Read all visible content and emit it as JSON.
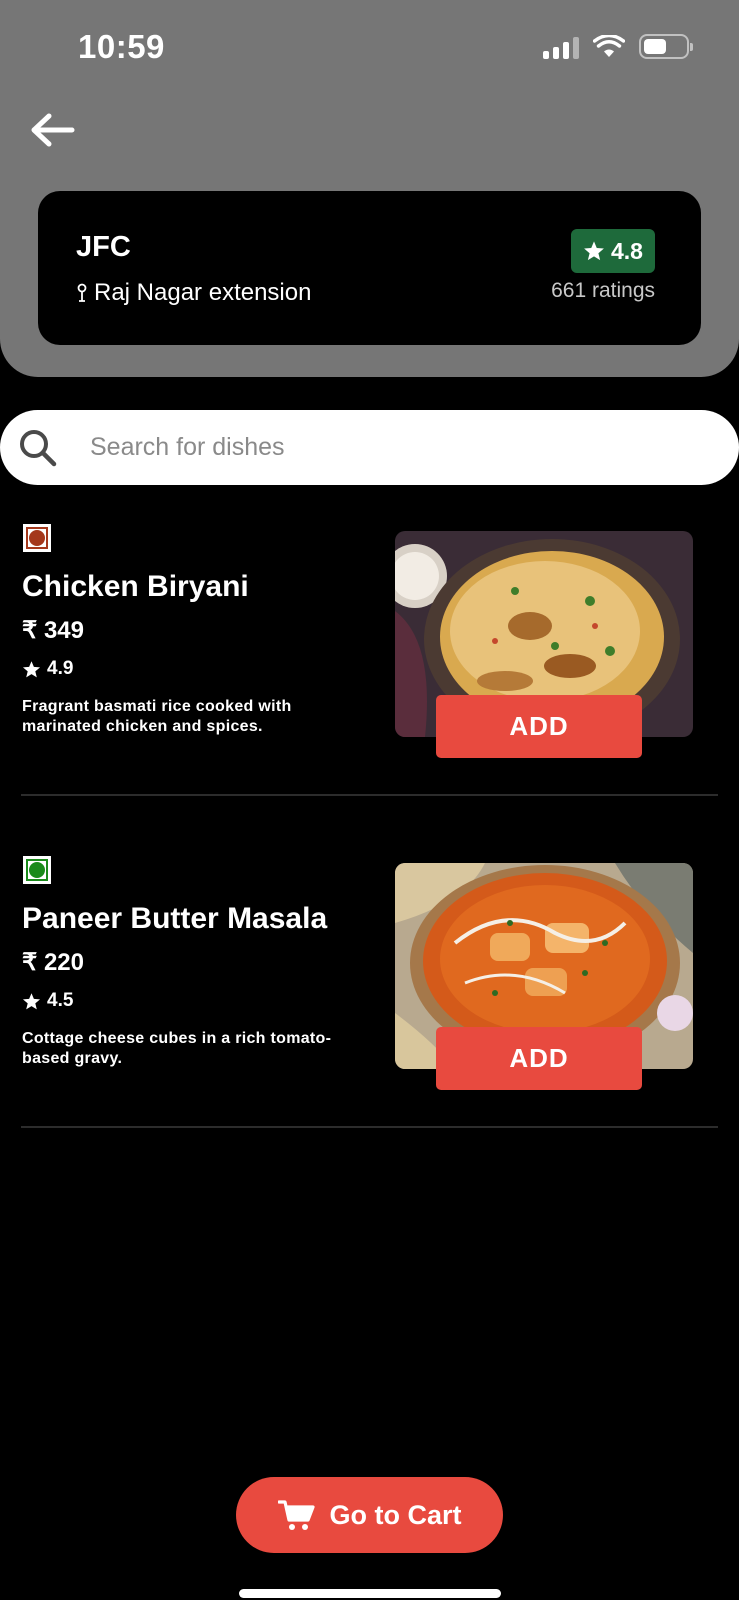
{
  "status_bar": {
    "time": "10:59"
  },
  "restaurant": {
    "name": "JFC",
    "location": "Raj Nagar extension",
    "rating": "4.8",
    "rating_count": "661 ratings",
    "rating_color": "#1e6a3b"
  },
  "search": {
    "placeholder": "Search for dishes"
  },
  "dishes": [
    {
      "type": "non-veg",
      "type_color": "#a4381c",
      "name": "Chicken Biryani",
      "price": "₹ 349",
      "rating": "4.9",
      "description": "Fragrant basmati rice cooked with marinated chicken and spices.",
      "add_label": "ADD"
    },
    {
      "type": "veg",
      "type_color": "#1a8a1a",
      "name": "Paneer Butter Masala",
      "price": "₹ 220",
      "rating": "4.5",
      "description": "Cottage cheese cubes in a rich tomato-based gravy.",
      "add_label": "ADD"
    }
  ],
  "cart_button": {
    "label": "Go to Cart"
  },
  "colors": {
    "accent": "#e84a3f",
    "header_bg": "#767676",
    "background": "#000000"
  }
}
